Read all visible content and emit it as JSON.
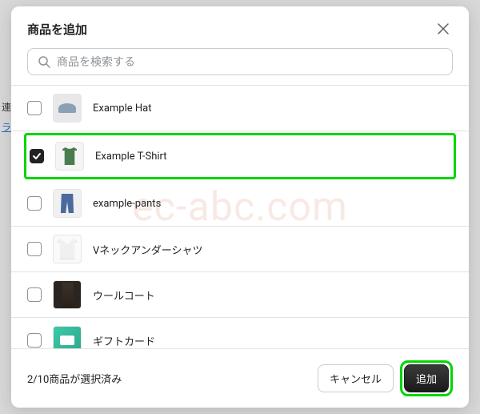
{
  "modal": {
    "title": "商品を追加",
    "search_placeholder": "商品を検索する",
    "selection_status": "2/10商品が選択済み",
    "cancel_label": "キャンセル",
    "add_label": "追加"
  },
  "products": [
    {
      "name": "Example Hat",
      "checked": false
    },
    {
      "name": "Example T-Shirt",
      "checked": true
    },
    {
      "name": "example-pants",
      "checked": false
    },
    {
      "name": "Vネックアンダーシャツ",
      "checked": false
    },
    {
      "name": "ウールコート",
      "checked": false
    },
    {
      "name": "ギフトカード",
      "checked": false
    }
  ],
  "watermark": "ec-abc.com",
  "background": {
    "text1": "連",
    "text2": "ラ"
  }
}
